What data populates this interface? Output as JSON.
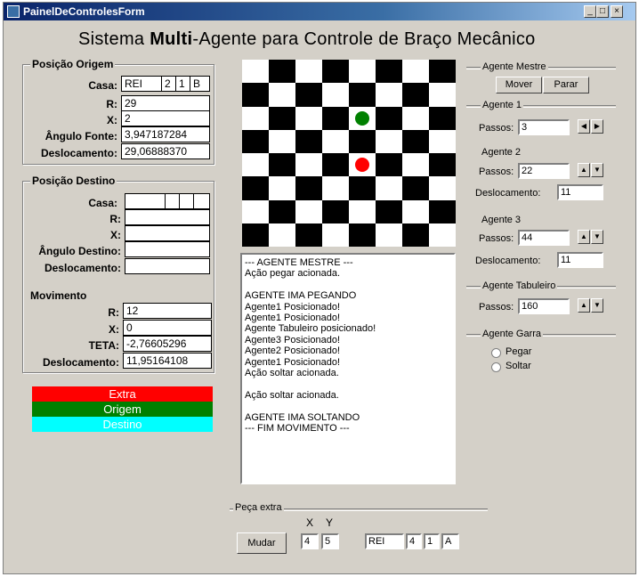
{
  "window": {
    "title": "PainelDeControlesForm",
    "buttons": {
      "minimize": "_",
      "maximize": "□",
      "close": "×"
    }
  },
  "app_title": {
    "pre": "Sistema ",
    "bold": "Multi",
    "post": "-Agente para Controle de Braço Mecânico"
  },
  "origem": {
    "group_label": "Posição Origem",
    "casa_label": "Casa:",
    "casa": [
      "REI",
      "2",
      "1",
      "B"
    ],
    "r_label": "R:",
    "r": "29",
    "x_label": "X:",
    "x": "2",
    "angulo_label": "Ângulo Fonte:",
    "angulo": "3,947187284",
    "desloc_label": "Deslocamento:",
    "desloc": "29,06888370"
  },
  "destino": {
    "group_label": "Posição Destino",
    "casa_label": "Casa:",
    "casa": [
      "",
      "",
      "",
      ""
    ],
    "r_label": "R:",
    "r": "",
    "x_label": "X:",
    "x": "",
    "angulo_label": "Ângulo Destino:",
    "angulo": "",
    "desloc_label": "Deslocamento:",
    "desloc": ""
  },
  "movimento": {
    "label": "Movimento",
    "r_label": "R:",
    "r": "12",
    "x_label": "X:",
    "x": "0",
    "teta_label": "TETA:",
    "teta": "-2,76605296",
    "desloc_label": "Deslocamento:",
    "desloc": "11,95164108"
  },
  "legend": [
    {
      "label": "Extra",
      "color": "#ff0000",
      "text_color": "#ffffff"
    },
    {
      "label": "Origem",
      "color": "#008000",
      "text_color": "#ffffff"
    },
    {
      "label": "Destino",
      "color": "#00ffff",
      "text_color": "#ffffff"
    }
  ],
  "board": {
    "light": "#ffffff",
    "dark": "#000000",
    "pieces": [
      {
        "name": "green-piece",
        "color": "#008000",
        "col": 4,
        "row": 2
      },
      {
        "name": "red-piece",
        "color": "#ff0000",
        "col": 4,
        "row": 4
      }
    ]
  },
  "log_lines": [
    "--- AGENTE MESTRE ---",
    "Ação pegar acionada.",
    "",
    "AGENTE IMA PEGANDO",
    "Agente1 Posicionado!",
    "Agente1 Posicionado!",
    "Agente Tabuleiro posicionado!",
    "Agente3 Posicionado!",
    "Agente2 Posicionado!",
    "Agente1 Posicionado!",
    "Ação soltar acionada.",
    "",
    "Ação soltar acionada.",
    "",
    "AGENTE IMA SOLTANDO",
    "--- FIM MOVIMENTO ---"
  ],
  "mestre": {
    "label": "Agente Mestre",
    "mover": "Mover",
    "parar": "Parar"
  },
  "agente1": {
    "label": "Agente 1",
    "passos_label": "Passos:",
    "passos": "3"
  },
  "agente2": {
    "label": "Agente 2",
    "passos_label": "Passos:",
    "passos": "22",
    "desloc_label": "Deslocamento:",
    "desloc": "11"
  },
  "agente3": {
    "label": "Agente 3",
    "passos_label": "Passos:",
    "passos": "44",
    "desloc_label": "Deslocamento:",
    "desloc": "11"
  },
  "tabuleiro": {
    "label": "Agente Tabuleiro",
    "passos_label": "Passos:",
    "passos": "160"
  },
  "garra": {
    "label": "Agente Garra",
    "pegar": "Pegar",
    "soltar": "Soltar"
  },
  "peca_extra": {
    "label": "Peça extra",
    "x_header": "X",
    "y_header": "Y",
    "mudar": "Mudar",
    "x": "4",
    "y": "5",
    "casa": [
      "REI",
      "4",
      "1",
      "A"
    ]
  }
}
